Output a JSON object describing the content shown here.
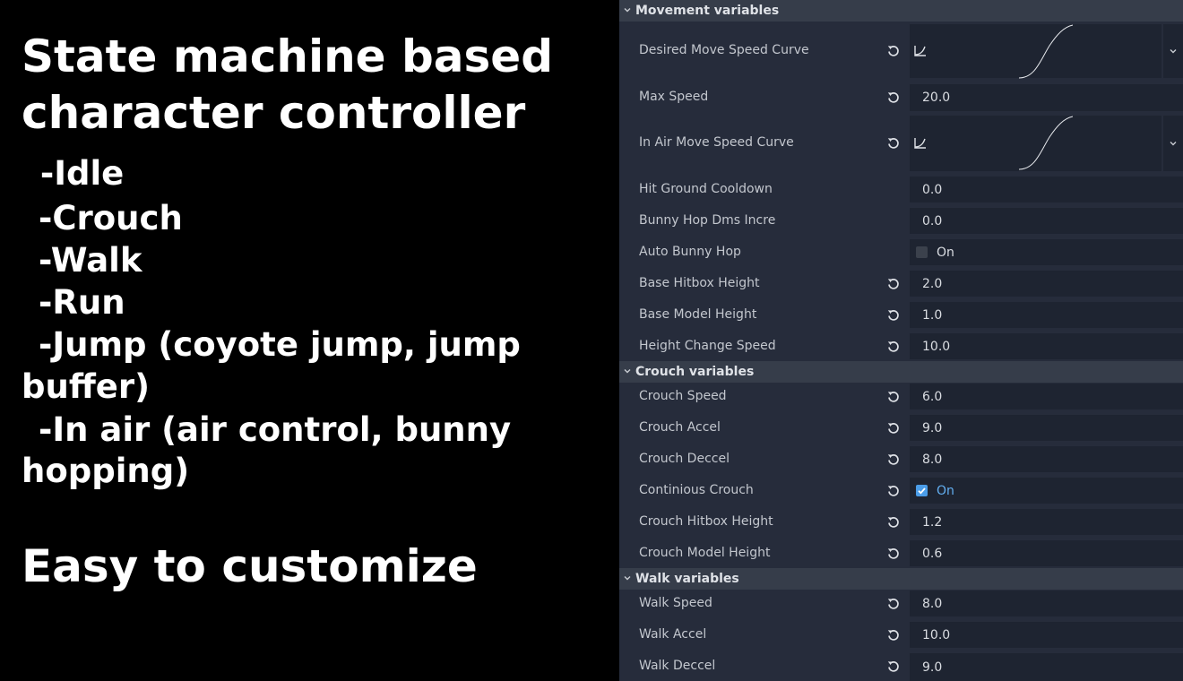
{
  "promo": {
    "title_line_1": "State machine based",
    "title_line_2": "character controller",
    "features": [
      " -Idle",
      "-Crouch",
      "-Walk",
      "-Run",
      "-Jump (coyote jump, jump",
      "buffer)",
      "-In air (air control, bunny",
      "hopping)"
    ],
    "tagline": "Easy to customize"
  },
  "inspector": {
    "sections": {
      "movement": "Movement variables",
      "crouch": "Crouch variables",
      "walk": "Walk variables"
    },
    "movement": {
      "desired_curve_label": "Desired Move Speed Curve",
      "max_speed_label": "Max Speed",
      "max_speed_value": "20.0",
      "in_air_curve_label": "In Air Move Speed Curve",
      "hit_ground_label": "Hit Ground Cooldown",
      "hit_ground_value": "0.0",
      "bunny_incre_label": "Bunny Hop Dms Incre",
      "bunny_incre_value": "0.0",
      "auto_bunny_label": "Auto Bunny Hop",
      "auto_bunny_value": "On",
      "auto_bunny_checked": false,
      "base_hitbox_label": "Base Hitbox Height",
      "base_hitbox_value": "2.0",
      "base_model_label": "Base Model Height",
      "base_model_value": "1.0",
      "height_change_label": "Height Change Speed",
      "height_change_value": "10.0"
    },
    "crouch": {
      "speed_label": "Crouch Speed",
      "speed_value": "6.0",
      "accel_label": "Crouch Accel",
      "accel_value": "9.0",
      "deccel_label": "Crouch Deccel",
      "deccel_value": "8.0",
      "continious_label": "Continious Crouch",
      "continious_value": "On",
      "continious_checked": true,
      "hitbox_label": "Crouch Hitbox Height",
      "hitbox_value": "1.2",
      "model_label": "Crouch Model Height",
      "model_value": "0.6"
    },
    "walk": {
      "speed_label": "Walk Speed",
      "speed_value": "8.0",
      "accel_label": "Walk Accel",
      "accel_value": "10.0",
      "deccel_label": "Walk Deccel",
      "deccel_value": "9.0"
    }
  },
  "icons": {
    "revert": "revert-icon",
    "curve": "curve-icon",
    "dropdown": "chevron-down-icon",
    "collapse": "chevron-down-icon"
  },
  "colors": {
    "panel_bg": "#262c3b",
    "header_bg": "#363d4a",
    "field_bg": "#1e2431",
    "accent": "#4b9de8"
  }
}
